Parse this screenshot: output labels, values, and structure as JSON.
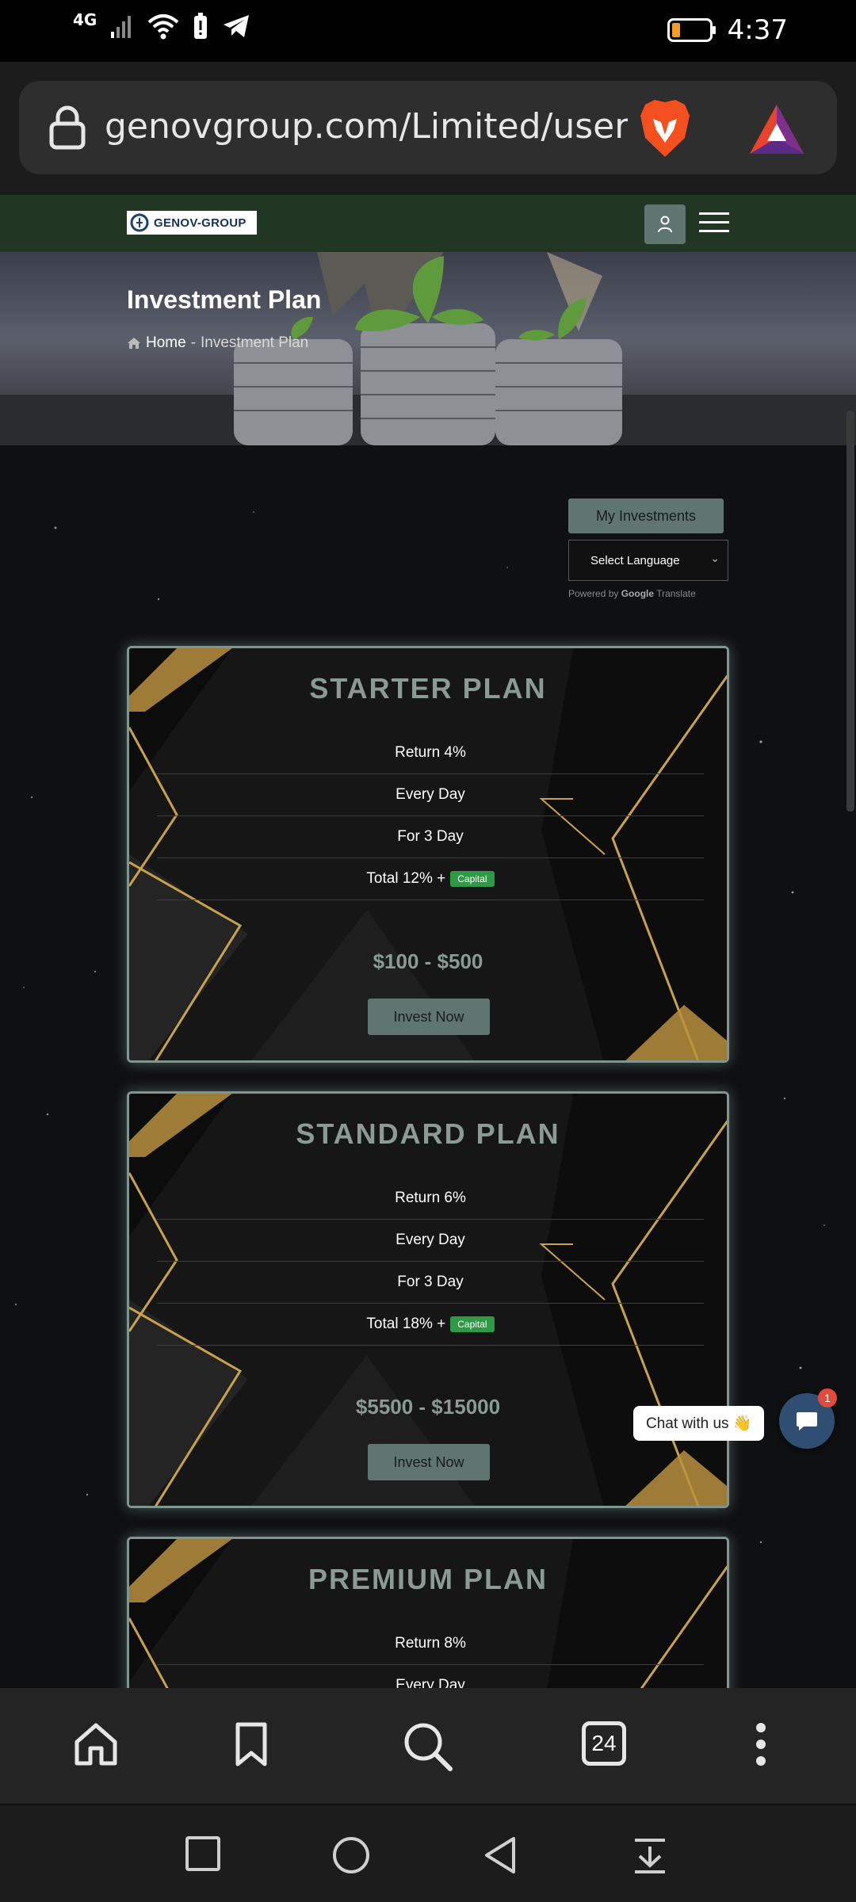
{
  "status": {
    "network": "4G",
    "time": "4:37"
  },
  "browser": {
    "url": "genovgroup.com/Limited/user/p"
  },
  "site": {
    "logo_text": "GENOV-GROUP",
    "hero_title": "Investment Plan",
    "breadcrumb_home": "Home",
    "breadcrumb_sep": " - ",
    "breadcrumb_current": "Investment Plan",
    "my_investments": "My Investments",
    "language_select": "Select Language",
    "powered_by": "Powered by",
    "google": "Google",
    "translate": "Translate"
  },
  "plans": [
    {
      "title": "STARTER PLAN",
      "return": "Return 4%",
      "frequency": "Every Day",
      "duration": "For 3 Day",
      "total": "Total 12% +",
      "capital": "Capital",
      "range": "$100 - $500",
      "button": "Invest Now"
    },
    {
      "title": "STANDARD PLAN",
      "return": "Return 6%",
      "frequency": "Every Day",
      "duration": "For 3 Day",
      "total": "Total 18% +",
      "capital": "Capital",
      "range": "$5500 - $15000",
      "button": "Invest Now"
    },
    {
      "title": "PREMIUM PLAN",
      "return": "Return 8%",
      "frequency": "Every Day"
    }
  ],
  "chat": {
    "label": "Chat with us 👋",
    "badge": "1"
  },
  "toolbar": {
    "tab_count": "24"
  },
  "colors": {
    "accent": "#5f7670",
    "nav_green": "#223624",
    "gold": "#c9a24a",
    "capital_green": "#2e9a45"
  }
}
